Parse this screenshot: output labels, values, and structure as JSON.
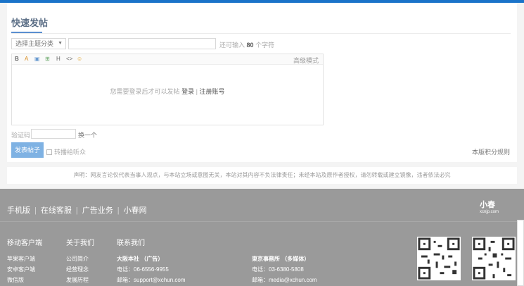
{
  "post": {
    "title": "快速发帖",
    "category_select": "选择主题分类",
    "char_hint_prefix": "还可输入",
    "char_hint_count": "80",
    "char_hint_suffix": "个字符",
    "toolbar": {
      "bold": "B",
      "color": "A",
      "image": "▣",
      "link": "⊞",
      "heading": "H",
      "code": "<>",
      "emoji": "☺",
      "advanced": "高级模式"
    },
    "login_prompt": "您需要登录后才可以发帖",
    "login_link": "登录",
    "separator": "|",
    "register_link": "注册账号",
    "captcha_label": "验证码",
    "captcha_switch": "换一个",
    "submit": "发表帖子",
    "sync_label": "转播给听众",
    "rules_link": "本版积分规则"
  },
  "disclaimer": "声明：网友言论仅代表当事人观点，与本站立场或意图无关，本站对其内容不负法律责任；未经本站及原作者授权，请勿转载或建立镜像，违者依法必究",
  "footer": {
    "links": [
      "手机版",
      "在线客服",
      "广告业务",
      "小春网"
    ],
    "logo_text": "小春",
    "logo_sub": "xcnjp.com",
    "col_mobile": {
      "heading": "移动客户端",
      "items": [
        "苹果客户端",
        "安卓客户端",
        "微信版"
      ]
    },
    "col_about": {
      "heading": "关于我们",
      "items": [
        "公司简介",
        "经营理念",
        "发展历程"
      ]
    },
    "col_contact": {
      "heading": "联系我们"
    },
    "osaka": {
      "title": "大阪本社 （广告）",
      "phone": "电话：06-6556-9955",
      "email": "邮箱：support@xchun.com"
    },
    "tokyo": {
      "title": "東京事務所 （多媒体）",
      "phone": "电话：03-6380-5808",
      "email": "邮箱：media@xchun.com"
    }
  }
}
